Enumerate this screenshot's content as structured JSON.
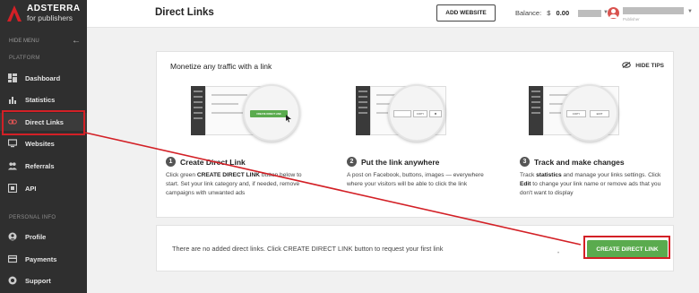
{
  "brand": {
    "name": "ADSTERRA",
    "sub": "for publishers",
    "color": "#d32026"
  },
  "sidebar": {
    "hide_menu": "HIDE MENU",
    "platform_label": "PLATFORM",
    "personal_label": "PERSONAL INFO",
    "items": [
      {
        "label": "Dashboard",
        "icon": "dashboard-icon"
      },
      {
        "label": "Statistics",
        "icon": "statistics-icon"
      },
      {
        "label": "Direct Links",
        "icon": "link-icon",
        "active": true
      },
      {
        "label": "Websites",
        "icon": "monitor-icon"
      },
      {
        "label": "Referrals",
        "icon": "referrals-icon"
      },
      {
        "label": "API",
        "icon": "api-icon"
      },
      {
        "label": "Profile",
        "icon": "profile-icon"
      },
      {
        "label": "Payments",
        "icon": "payments-icon"
      },
      {
        "label": "Support",
        "icon": "support-icon"
      }
    ]
  },
  "header": {
    "title": "Direct Links",
    "add_website": "ADD WEBSITE",
    "balance_label": "Balance:",
    "balance_currency": "$",
    "balance_value": "0.00",
    "user_sub": "Publisher"
  },
  "tips": {
    "title": "Monetize any traffic with a link",
    "hide_tips": "HIDE TIPS",
    "illus_labels": {
      "create": "CREATE DIRECT LINK",
      "copy": "COPY",
      "edit": "EDIT"
    },
    "steps": [
      {
        "num": "1",
        "title": "Create Direct Link",
        "d1": "Click green ",
        "d_bold": "CREATE DIRECT LINK",
        "d2": " button below to start. Set your link category and, if needed, remove campaigns with unwanted ads"
      },
      {
        "num": "2",
        "title": "Put the link anywhere",
        "d1": "A post on Facebook, buttons, images — everywhere where your visitors will be able to click the link",
        "d_bold": "",
        "d2": ""
      },
      {
        "num": "3",
        "title": "Track and make changes",
        "d1": "Track ",
        "d_bold": "statistics",
        "d2": " and manage your links settings. Click ",
        "d_bold2": "Edit",
        "d3": " to change your link name or remove ads that you don't want to display"
      }
    ]
  },
  "links": {
    "empty_text": "There are no added direct links. Click CREATE DIRECT LINK button to request your first link",
    "create_button": "CREATE DIRECT LINK",
    "button_color": "#5aab4e"
  },
  "annotation": {
    "color": "#d32026"
  }
}
